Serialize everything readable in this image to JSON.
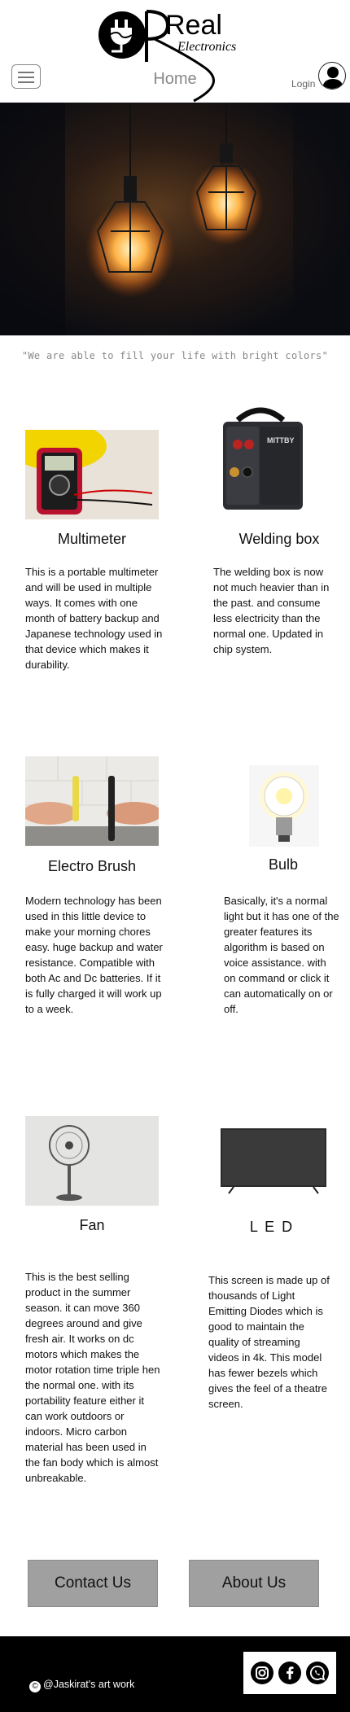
{
  "header": {
    "logo_text_main": "Real",
    "logo_text_sub": "Electronics",
    "title": "Home",
    "login_label": "Login"
  },
  "hero": {
    "image": "hanging-edison-bulbs-photo"
  },
  "tagline": "\"We are able to fill your life with bright colors\"",
  "products": [
    {
      "name": "Multimeter",
      "image": "multimeter-photo",
      "description": "This is a portable multimeter and will be used in multiple ways. It comes with one month of battery backup and Japanese technology used in that device which makes it durability."
    },
    {
      "name": "Welding box",
      "image": "welding-box-photo",
      "description": "The welding box is now not much heavier than in the past. and consume less electricity than the normal one. Updated in chip system."
    },
    {
      "name": "Electro Brush",
      "image": "electric-toothbrush-photo",
      "description": "Modern technology has been used in this little device to make your morning chores easy. huge backup and water resistance. Compatible with both Ac and Dc batteries. If it is fully charged it will work up to a week."
    },
    {
      "name": "Bulb",
      "image": "light-bulb-photo",
      "description": "Basically, it's a normal light but it has one of the greater features its algorithm is based on voice assistance. with on command or click it can automatically on or off."
    },
    {
      "name": "Fan",
      "image": "standing-fan-photo",
      "description": "This is the best selling product in the summer season. it can move 360 degrees around and give fresh air. It works on dc motors which makes the motor rotation time triple hen the normal one. with its portability feature either it can work outdoors or indoors. Micro carbon material has been used in the fan body which is almost unbreakable."
    },
    {
      "name": "L E D",
      "image": "led-tv-photo",
      "description": "This screen is made up of thousands of Light Emitting Diodes which is good to maintain the quality of streaming videos in 4k. This model has fewer bezels which gives the feel of a theatre screen."
    }
  ],
  "buttons": {
    "contact": "Contact Us",
    "about": "About Us"
  },
  "footer": {
    "copyright_symbol": "©",
    "credit": "@Jaskirat's art work",
    "social": [
      "instagram-icon",
      "facebook-icon",
      "whatsapp-icon"
    ]
  },
  "colors": {
    "button_bg": "#a0a0a0",
    "footer_bg": "#000000",
    "muted_text": "#888888"
  }
}
